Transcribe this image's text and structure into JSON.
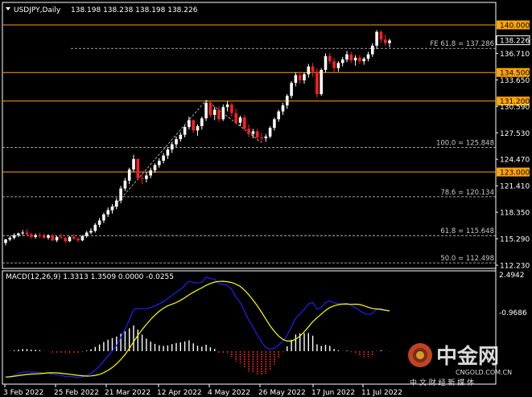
{
  "header": {
    "symbol_label": "USDJPY,Daily",
    "ohlc": "138.198 138.238 138.198 138.226"
  },
  "macd": {
    "label": "MACD(12,26,9) 1.3313 1.3509 0.0000 -0.0255",
    "ticks": [
      "2.4942",
      "-0.9686"
    ]
  },
  "price_ticks": [
    "136.710",
    "133.650",
    "130.590",
    "127.530",
    "124.470",
    "121.410",
    "118.350",
    "115.290",
    "112.230"
  ],
  "current_price": "138.226",
  "level_lines": [
    {
      "price": 140.0,
      "label": "140.000"
    },
    {
      "price": 134.5,
      "label": "134.500"
    },
    {
      "price": 131.2,
      "label": "131.200"
    },
    {
      "price": 123.0,
      "label": "123.000"
    }
  ],
  "fib_lines": [
    {
      "price": 137.286,
      "label": "FE 61.8 = 137.286"
    },
    {
      "price": 125.848,
      "label": "100.0 = 125.848"
    },
    {
      "price": 120.134,
      "label": "78.6 = 120.134"
    },
    {
      "price": 115.648,
      "label": "61.8 = 115.648"
    },
    {
      "price": 112.498,
      "label": "50.0 = 112.498"
    }
  ],
  "date_ticks": [
    "3 Feb 2022",
    "25 Feb 2022",
    "21 Mar 2022",
    "12 Apr 2022",
    "4 May 2022",
    "26 May 2022",
    "17 Jun 2022",
    "11 Jul 2022"
  ],
  "watermark": {
    "brand": "中金网",
    "url": "CNGOLD.COM.CN",
    "tagline": "中 文 财 经 新 媒 体"
  },
  "colors": {
    "background": "#000000",
    "bull": "#ffffff",
    "bear": "#ff2020",
    "level": "#ffa500",
    "macd_main": "#2020ff",
    "macd_signal": "#ffff00",
    "macd_hist_pos": "#ffffff",
    "macd_hist_neg": "#ff2020"
  },
  "chart_data": {
    "type": "candlestick",
    "symbol": "USDJPY",
    "timeframe": "Daily",
    "y_range": [
      111.0,
      141.8
    ],
    "bars_approx": [
      [
        114.8,
        115.3,
        114.5,
        115.2
      ],
      [
        115.2,
        115.6,
        115.0,
        115.4
      ],
      [
        115.4,
        115.9,
        115.2,
        115.7
      ],
      [
        115.7,
        116.0,
        115.5,
        115.9
      ],
      [
        115.9,
        116.3,
        115.7,
        116.0
      ],
      [
        116.0,
        116.4,
        115.7,
        115.8
      ],
      [
        115.8,
        116.0,
        115.3,
        115.5
      ],
      [
        115.5,
        115.9,
        115.3,
        115.7
      ],
      [
        115.7,
        116.0,
        115.4,
        115.6
      ],
      [
        115.6,
        115.9,
        115.3,
        115.4
      ],
      [
        115.4,
        115.8,
        115.2,
        115.7
      ],
      [
        115.7,
        115.8,
        115.0,
        115.1
      ],
      [
        115.1,
        115.6,
        114.9,
        115.5
      ],
      [
        115.5,
        115.9,
        115.3,
        115.4
      ],
      [
        115.4,
        115.5,
        114.8,
        115.0
      ],
      [
        115.0,
        115.6,
        114.9,
        115.5
      ],
      [
        115.5,
        115.8,
        115.2,
        115.3
      ],
      [
        115.3,
        115.5,
        114.9,
        115.1
      ],
      [
        115.1,
        115.7,
        115.0,
        115.6
      ],
      [
        115.6,
        116.2,
        115.4,
        116.0
      ],
      [
        116.0,
        116.5,
        115.8,
        116.2
      ],
      [
        116.2,
        117.1,
        116.0,
        116.9
      ],
      [
        116.9,
        117.7,
        116.6,
        117.4
      ],
      [
        117.4,
        118.3,
        117.1,
        118.1
      ],
      [
        118.1,
        118.9,
        117.8,
        118.6
      ],
      [
        118.6,
        119.3,
        118.2,
        119.0
      ],
      [
        119.0,
        120.0,
        118.7,
        119.7
      ],
      [
        119.7,
        121.4,
        119.4,
        121.1
      ],
      [
        121.1,
        122.3,
        120.8,
        122.0
      ],
      [
        122.0,
        123.5,
        121.6,
        123.3
      ],
      [
        123.3,
        125.0,
        123.0,
        124.5
      ],
      [
        124.5,
        124.6,
        122.0,
        122.3
      ],
      [
        122.3,
        122.8,
        121.6,
        122.2
      ],
      [
        122.2,
        123.0,
        121.8,
        122.6
      ],
      [
        122.6,
        123.5,
        122.3,
        123.2
      ],
      [
        123.2,
        124.0,
        122.9,
        123.8
      ],
      [
        123.8,
        124.6,
        123.5,
        124.3
      ],
      [
        124.3,
        125.2,
        124.0,
        124.9
      ],
      [
        124.9,
        125.9,
        124.5,
        125.6
      ],
      [
        125.6,
        126.5,
        125.2,
        126.2
      ],
      [
        126.2,
        127.1,
        125.9,
        126.8
      ],
      [
        126.8,
        127.6,
        126.5,
        127.3
      ],
      [
        127.3,
        128.4,
        127.0,
        128.2
      ],
      [
        128.2,
        129.4,
        127.9,
        129.0
      ],
      [
        129.0,
        129.0,
        127.5,
        127.8
      ],
      [
        127.8,
        128.5,
        127.2,
        128.3
      ],
      [
        128.3,
        129.4,
        127.9,
        129.2
      ],
      [
        129.2,
        131.3,
        128.9,
        131.0
      ],
      [
        131.0,
        131.2,
        129.3,
        129.6
      ],
      [
        129.6,
        130.5,
        129.0,
        130.2
      ],
      [
        130.2,
        130.6,
        128.8,
        129.1
      ],
      [
        129.1,
        130.8,
        128.9,
        130.5
      ],
      [
        130.5,
        131.2,
        130.0,
        130.8
      ],
      [
        130.8,
        131.0,
        129.4,
        129.8
      ],
      [
        129.8,
        130.3,
        128.5,
        128.7
      ],
      [
        128.7,
        129.5,
        128.3,
        129.3
      ],
      [
        129.3,
        129.6,
        127.8,
        128.0
      ],
      [
        128.0,
        128.5,
        127.0,
        127.4
      ],
      [
        127.4,
        128.0,
        126.9,
        127.7
      ],
      [
        127.7,
        128.0,
        126.6,
        127.0
      ],
      [
        127.0,
        127.5,
        126.4,
        126.9
      ],
      [
        126.9,
        127.4,
        126.5,
        127.1
      ],
      [
        127.1,
        128.3,
        126.9,
        128.1
      ],
      [
        128.1,
        129.3,
        127.8,
        129.1
      ],
      [
        129.1,
        130.2,
        128.8,
        130.0
      ],
      [
        130.0,
        131.0,
        129.6,
        130.7
      ],
      [
        130.7,
        132.0,
        130.3,
        131.8
      ],
      [
        131.8,
        133.5,
        131.5,
        133.3
      ],
      [
        133.3,
        134.5,
        132.9,
        134.2
      ],
      [
        134.2,
        134.6,
        133.2,
        133.6
      ],
      [
        133.6,
        134.5,
        133.2,
        134.3
      ],
      [
        134.3,
        135.5,
        133.9,
        135.2
      ],
      [
        135.2,
        135.6,
        134.0,
        134.6
      ],
      [
        134.6,
        135.0,
        131.6,
        132.0
      ],
      [
        132.0,
        135.0,
        131.8,
        134.8
      ],
      [
        134.8,
        136.7,
        134.5,
        136.4
      ],
      [
        136.4,
        136.8,
        135.5,
        135.8
      ],
      [
        135.8,
        136.2,
        134.5,
        135.0
      ],
      [
        135.0,
        135.8,
        134.6,
        135.6
      ],
      [
        135.6,
        136.3,
        135.2,
        136.0
      ],
      [
        136.0,
        137.0,
        135.7,
        136.6
      ],
      [
        136.6,
        136.9,
        135.6,
        135.9
      ],
      [
        135.9,
        136.5,
        135.3,
        136.2
      ],
      [
        136.2,
        136.5,
        135.5,
        135.8
      ],
      [
        135.8,
        136.3,
        135.4,
        136.1
      ],
      [
        136.1,
        136.9,
        135.8,
        136.6
      ],
      [
        136.6,
        137.9,
        136.3,
        137.6
      ],
      [
        137.6,
        139.4,
        137.2,
        139.2
      ],
      [
        139.2,
        139.4,
        137.9,
        138.3
      ],
      [
        138.3,
        138.9,
        137.6,
        137.9
      ],
      [
        137.9,
        138.4,
        137.4,
        138.2
      ]
    ]
  }
}
